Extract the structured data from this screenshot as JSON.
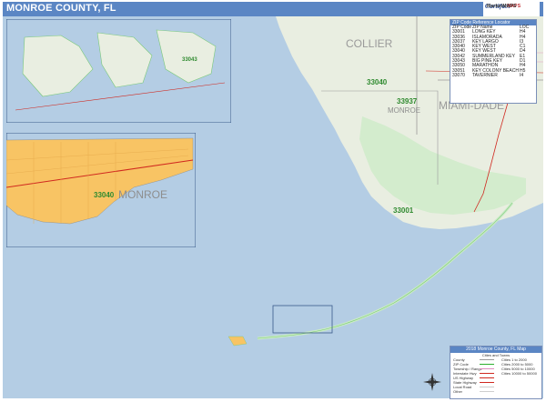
{
  "title": "MONROE COUNTY, FL",
  "logo": {
    "brand": "Cartifact",
    "tag": "MAPS",
    "extra": "MarketMAPS"
  },
  "counties": {
    "collier": "COLLIER",
    "miami_dade": "MIAMI-DADE",
    "monroe": "MONROE",
    "monroe_inset": "MONROE"
  },
  "zip_labels": {
    "z33040": "33040",
    "z33937": "33937",
    "z33001": "33001",
    "z33040_inset": "33040",
    "z33043_small": "33043"
  },
  "zip_table": {
    "header": "ZIP Code Reference Locator",
    "columns": [
      "ZIP Code",
      "ZIP Name",
      "LOC"
    ],
    "rows": [
      [
        "33001",
        "LONG KEY",
        "H4"
      ],
      [
        "33036",
        "ISLAMORADA",
        "H4"
      ],
      [
        "33037",
        "KEY LARGO",
        "I3"
      ],
      [
        "33040",
        "KEY WEST",
        "C1"
      ],
      [
        "33040",
        "KEY WEST",
        "D4"
      ],
      [
        "33042",
        "SUMMERLAND KEY",
        "E1"
      ],
      [
        "33043",
        "BIG PINE KEY",
        "D1"
      ],
      [
        "33050",
        "MARATHON",
        "H4"
      ],
      [
        "33051",
        "KEY COLONY BEACH",
        "H5"
      ],
      [
        "33070",
        "TAVERNIER",
        "I4"
      ]
    ]
  },
  "legend": {
    "title": "2018 Monroe County, FL Map",
    "subtitle": "Cities and Towns",
    "rows": [
      {
        "label": "County",
        "note": "Cities 1 to 2000"
      },
      {
        "label": "ZIP Code",
        "note": "Cities 2000 to 5000"
      },
      {
        "label": "Township / Range",
        "note": "Cities 5000 to 10000"
      },
      {
        "label": "Interstate Hwy",
        "note": "Cities 10000 to 50000"
      },
      {
        "label": "US Highway",
        "note": ""
      },
      {
        "label": "State Highway",
        "note": ""
      },
      {
        "label": "Local Road",
        "note": ""
      },
      {
        "label": "Other",
        "note": ""
      }
    ],
    "colors": {
      "county": "#9a9a9a",
      "zip": "#2fae2f",
      "township": "#e08cc0",
      "interstate": "#d0281f",
      "us_hwy": "#d0281f",
      "state_hwy": "#d0281f",
      "local": "#ffffff",
      "other": "#cfcfcf"
    }
  },
  "colors": {
    "water": "#b4cde4",
    "land_mainland": "#e9eee1",
    "wetland": "#c9ebc4",
    "keywest_city": "#f8c464",
    "title_bg": "#5b86c4"
  }
}
